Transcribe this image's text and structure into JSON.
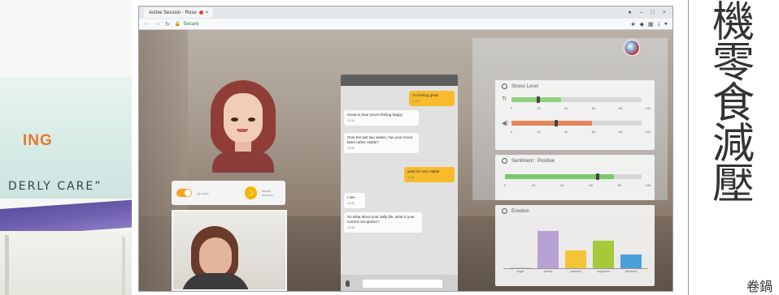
{
  "left_banner": {
    "title": "ING",
    "subtitle": "DERLY CARE”"
  },
  "browser": {
    "tab_title": "Active Session - Rose",
    "url_text": "Secure",
    "tab_recording_color": "#e53935"
  },
  "chat": {
    "messages": [
      {
        "from": "user",
        "text": "I'm feeling great",
        "time": "10:31"
      },
      {
        "from": "bot",
        "text": "Great to hear you're feeling happy",
        "time": "10:31"
      },
      {
        "from": "bot",
        "text": "Over the last two weeks, has your mood been rather stable?",
        "time": "10:32"
      },
      {
        "from": "user",
        "text": "yeah it's very stable",
        "time": "10:32"
      },
      {
        "from": "bot",
        "text": "I see",
        "time": "10:32"
      },
      {
        "from": "bot",
        "text": "So what about your daily life, what is your current occupation?",
        "time": "10:33"
      }
    ]
  },
  "controls": {
    "toggle_label": "Lip sync",
    "button_label": "Assist session",
    "accent": "#f5a623"
  },
  "stress_panel": {
    "title": "Stress Level",
    "bars": [
      {
        "icon": "Tr",
        "value": 0.38,
        "color": "#8fd07a"
      },
      {
        "icon": "◀)",
        "value": 0.62,
        "color": "#e0865a"
      }
    ],
    "ticks": [
      "0",
      "20",
      "40",
      "60",
      "80",
      "100"
    ]
  },
  "sentiment_panel": {
    "title": "Sentiment : Positive",
    "value": 0.8,
    "color": "#7ac86a",
    "ticks": [
      "0",
      "20",
      "40",
      "60",
      "80",
      "100"
    ]
  },
  "emotion_panel": {
    "title": "Emotion",
    "categories": [
      "anger",
      "anxiety",
      "sadness",
      "happiness",
      "tiredness"
    ],
    "values": [
      0.02,
      0.75,
      0.35,
      0.55,
      0.28
    ],
    "colors": [
      "#c9c9c9",
      "#b8a2d4",
      "#f2c436",
      "#a6c839",
      "#4aa0d8"
    ]
  },
  "cjk": {
    "chars": [
      "機",
      "零",
      "食",
      "減",
      "壓"
    ],
    "footer": "卷鍋"
  }
}
